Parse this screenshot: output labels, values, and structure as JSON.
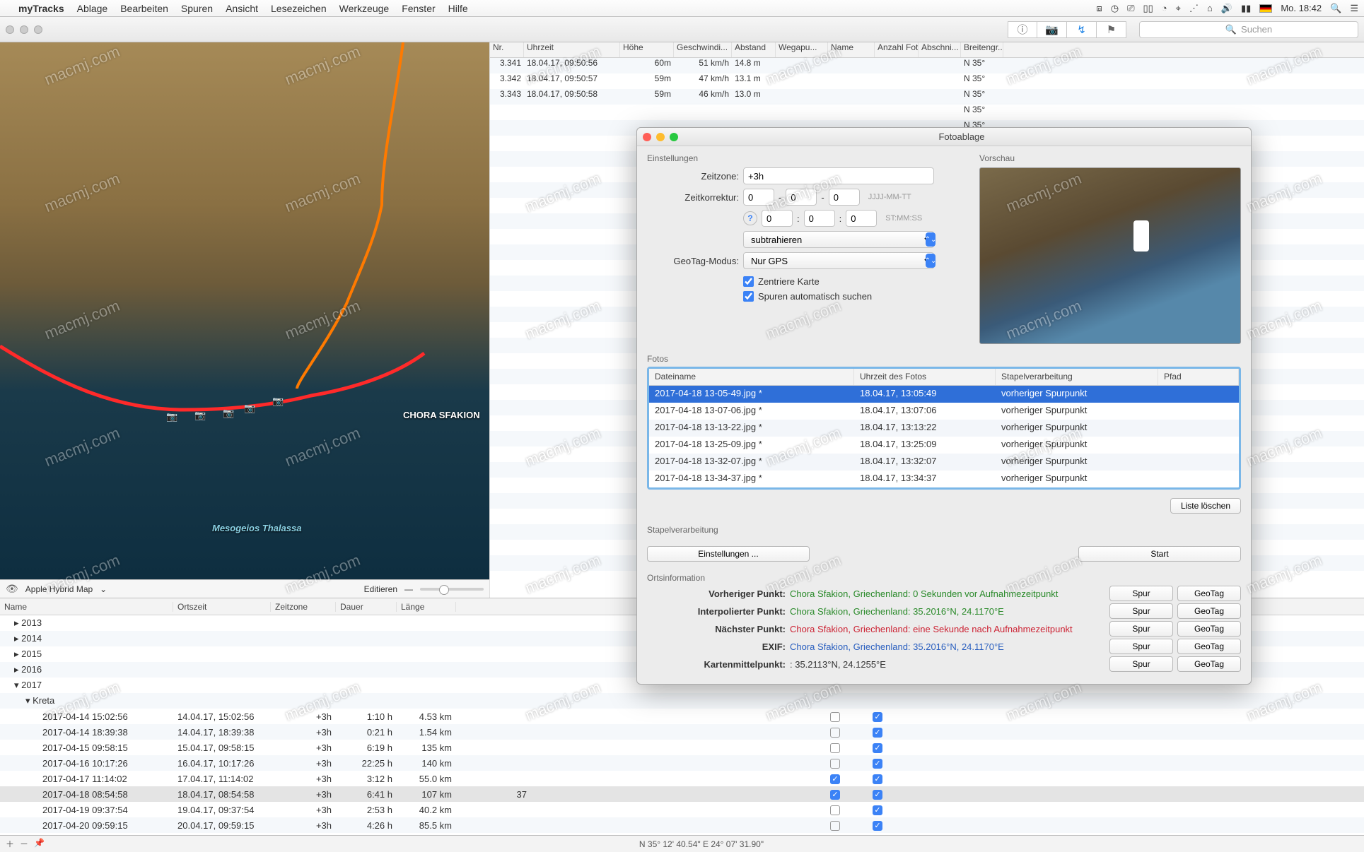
{
  "menubar": {
    "app": "myTracks",
    "items": [
      "Ablage",
      "Bearbeiten",
      "Spuren",
      "Ansicht",
      "Lesezeichen",
      "Werkzeuge",
      "Fenster",
      "Hilfe"
    ],
    "clock": "Mo. 18:42"
  },
  "toolbar": {
    "search_placeholder": "Suchen"
  },
  "map": {
    "place_label": "CHORA SFAKION",
    "sea_label": "Mesogeios Thalassa",
    "source_label": "Apple Hybrid Map",
    "edit_label": "Editieren"
  },
  "point_table": {
    "headers": [
      "Nr.",
      "Uhrzeit",
      "Höhe",
      "Geschwindi...",
      "Abstand",
      "Wegapu...",
      "Name",
      "Anzahl Fotos",
      "Abschni...",
      "Breitengr..."
    ],
    "rows": [
      {
        "nr": "3.341",
        "time": "18.04.17, 09:50:56",
        "hoehe": "60m",
        "spd": "51 km/h",
        "dist": "14.8 m",
        "lat": "N 35°"
      },
      {
        "nr": "3.342",
        "time": "18.04.17, 09:50:57",
        "hoehe": "59m",
        "spd": "47 km/h",
        "dist": "13.1 m",
        "lat": "N 35°"
      },
      {
        "nr": "3.343",
        "time": "18.04.17, 09:50:58",
        "hoehe": "59m",
        "spd": "46 km/h",
        "dist": "13.0 m",
        "lat": "N 35°"
      }
    ],
    "lat_fill": "N 35°",
    "fill_rows": 31
  },
  "track_table": {
    "headers": [
      "Name",
      "Ortszeit",
      "Zeitzone",
      "Dauer",
      "Länge"
    ],
    "years": [
      "2013",
      "2014",
      "2015",
      "2016"
    ],
    "open_year": "2017",
    "open_child": "Kreta",
    "rows": [
      {
        "name": "2017-04-14 15:02:56",
        "ort": "14.04.17, 15:02:56",
        "tz": "+3h",
        "dauer": "1:10 h",
        "len": "4.53 km",
        "c1": false,
        "c2": true
      },
      {
        "name": "2017-04-14 18:39:38",
        "ort": "14.04.17, 18:39:38",
        "tz": "+3h",
        "dauer": "0:21 h",
        "len": "1.54 km",
        "c1": false,
        "c2": true
      },
      {
        "name": "2017-04-15 09:58:15",
        "ort": "15.04.17, 09:58:15",
        "tz": "+3h",
        "dauer": "6:19 h",
        "len": "135 km",
        "c1": false,
        "c2": true
      },
      {
        "name": "2017-04-16 10:17:26",
        "ort": "16.04.17, 10:17:26",
        "tz": "+3h",
        "dauer": "22:25 h",
        "len": "140 km",
        "c1": false,
        "c2": true
      },
      {
        "name": "2017-04-17 11:14:02",
        "ort": "17.04.17, 11:14:02",
        "tz": "+3h",
        "dauer": "3:12 h",
        "len": "55.0 km",
        "c1": true,
        "c2": true
      },
      {
        "name": "2017-04-18 08:54:58",
        "ort": "18.04.17, 08:54:58",
        "tz": "+3h",
        "dauer": "6:41 h",
        "len": "107 km",
        "c1": true,
        "c2": true,
        "sel": true,
        "extra": "37"
      },
      {
        "name": "2017-04-19 09:37:54",
        "ort": "19.04.17, 09:37:54",
        "tz": "+3h",
        "dauer": "2:53 h",
        "len": "40.2 km",
        "c1": false,
        "c2": true
      },
      {
        "name": "2017-04-20 09:59:15",
        "ort": "20.04.17, 09:59:15",
        "tz": "+3h",
        "dauer": "4:26 h",
        "len": "85.5 km",
        "c1": false,
        "c2": true
      }
    ]
  },
  "statusbar": {
    "coord": "N 35° 12' 40.54\"  E 24° 07' 31.90\""
  },
  "panel": {
    "title": "Fotoablage",
    "sec_settings": "Einstellungen",
    "sec_preview": "Vorschau",
    "tz_label": "Zeitzone:",
    "tz_value": "+3h",
    "corr_label": "Zeitkorrektur:",
    "corr_d": "0",
    "corr_m": "0",
    "corr_y": "0",
    "corr_h": "0",
    "corr_mi": "0",
    "corr_s": "0",
    "hint_date": "JJJJ-MM-TT",
    "hint_time": "ST:MM:SS",
    "op_select": "subtrahieren",
    "geotag_label": "GeoTag-Modus:",
    "geotag_value": "Nur GPS",
    "cb_center": "Zentriere Karte",
    "cb_autosearch": "Spuren automatisch suchen",
    "photos_label": "Fotos",
    "photo_headers": [
      "Dateiname",
      "Uhrzeit des Fotos",
      "Stapelverarbeitung",
      "Pfad"
    ],
    "photos": [
      {
        "fn": "2017-04-18 13-05-49.jpg *",
        "t": "18.04.17, 13:05:49",
        "b": "vorheriger Spurpunkt",
        "sel": true
      },
      {
        "fn": "2017-04-18 13-07-06.jpg *",
        "t": "18.04.17, 13:07:06",
        "b": "vorheriger Spurpunkt"
      },
      {
        "fn": "2017-04-18 13-13-22.jpg *",
        "t": "18.04.17, 13:13:22",
        "b": "vorheriger Spurpunkt"
      },
      {
        "fn": "2017-04-18 13-25-09.jpg *",
        "t": "18.04.17, 13:25:09",
        "b": "vorheriger Spurpunkt"
      },
      {
        "fn": "2017-04-18 13-32-07.jpg *",
        "t": "18.04.17, 13:32:07",
        "b": "vorheriger Spurpunkt"
      },
      {
        "fn": "2017-04-18 13-34-37.jpg *",
        "t": "18.04.17, 13:34:37",
        "b": "vorheriger Spurpunkt"
      }
    ],
    "btn_clear": "Liste löschen",
    "sec_batch": "Stapelverarbeitung",
    "btn_settings": "Einstellungen ...",
    "btn_start": "Start",
    "sec_loc": "Ortsinformation",
    "loc_prev_l": "Vorheriger Punkt:",
    "loc_prev_v": "Chora Sfakion, Griechenland: 0 Sekunden vor Aufnahmezeitpunkt",
    "loc_int_l": "Interpolierter Punkt:",
    "loc_int_v": "Chora Sfakion, Griechenland: 35.2016°N, 24.1170°E",
    "loc_next_l": "Nächster Punkt:",
    "loc_next_v": "Chora Sfakion, Griechenland: eine Sekunde nach Aufnahmezeitpunkt",
    "loc_exif_l": "EXIF:",
    "loc_exif_v": "Chora Sfakion, Griechenland: 35.2016°N, 24.1170°E",
    "loc_center_l": "Kartenmittelpunkt:",
    "loc_center_v": ": 35.2113°N, 24.1255°E",
    "btn_spur": "Spur",
    "btn_geotag": "GeoTag"
  },
  "watermark": "macmj.com"
}
